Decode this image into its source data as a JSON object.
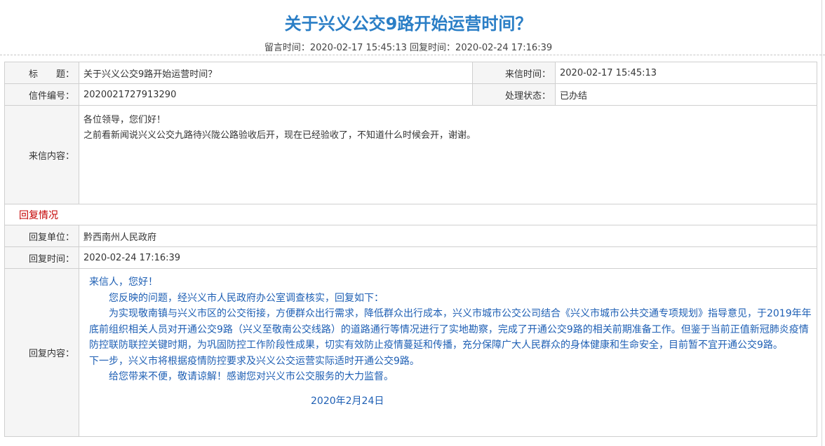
{
  "header": {
    "title": "关于兴义公交9路开始运营时间？",
    "meta_line": "留言时间：2020-02-17 15:45:13 回复时间：2020-02-24 17:16:39"
  },
  "letter": {
    "title_label": "标　　题：",
    "title_value": "关于兴义公交9路开始运营时间？",
    "received_label": "来信时间：",
    "received_value": "2020-02-17 15:45:13",
    "number_label": "信件编号：",
    "number_value": "2020021727913290",
    "status_label": "处理状态：",
    "status_value": "已办结",
    "content_label": "来信内容：",
    "content_lines": [
      "各位领导，您们好！",
      "之前看新闻说兴义公交九路待兴陇公路验收后开，现在已经验收了，不知道什么时候会开，谢谢。"
    ]
  },
  "reply": {
    "section_title": "回复情况",
    "unit_label": "回复单位：",
    "unit_value": "黔西南州人民政府",
    "time_label": "回复时间：",
    "time_value": "2020-02-24 17:16:39",
    "content_label": "回复内容：",
    "greeting": "来信人，您好！",
    "para1": "您反映的问题，经兴义市人民政府办公室调查核实，回复如下：",
    "para2": "为实现敬南镇与兴义市区的公交衔接，方便群众出行需求，降低群众出行成本，兴义市城市公交公司结合《兴义市城市公共交通专项规划》指导意见，于2019年年底前组织相关人员对开通公交9路（兴义至敬南公交线路）的道路通行等情况进行了实地勘察，完成了开通公交9路的相关前期准备工作。但鉴于当前正值新冠肺炎疫情防控联防联控关键时期，为巩固防控工作阶段性成果，切实有效防止疫情蔓延和传播，充分保障广大人民群众的身体健康和生命安全，目前暂不宜开通公交9路。",
    "para3": "下一步，兴义市将根据疫情防控要求及兴义公交运营实际适时开通公交9路。",
    "para4": "给您带来不便，敬请谅解！感谢您对兴义市公交服务的大力监督。",
    "date": "2020年2月24日"
  }
}
